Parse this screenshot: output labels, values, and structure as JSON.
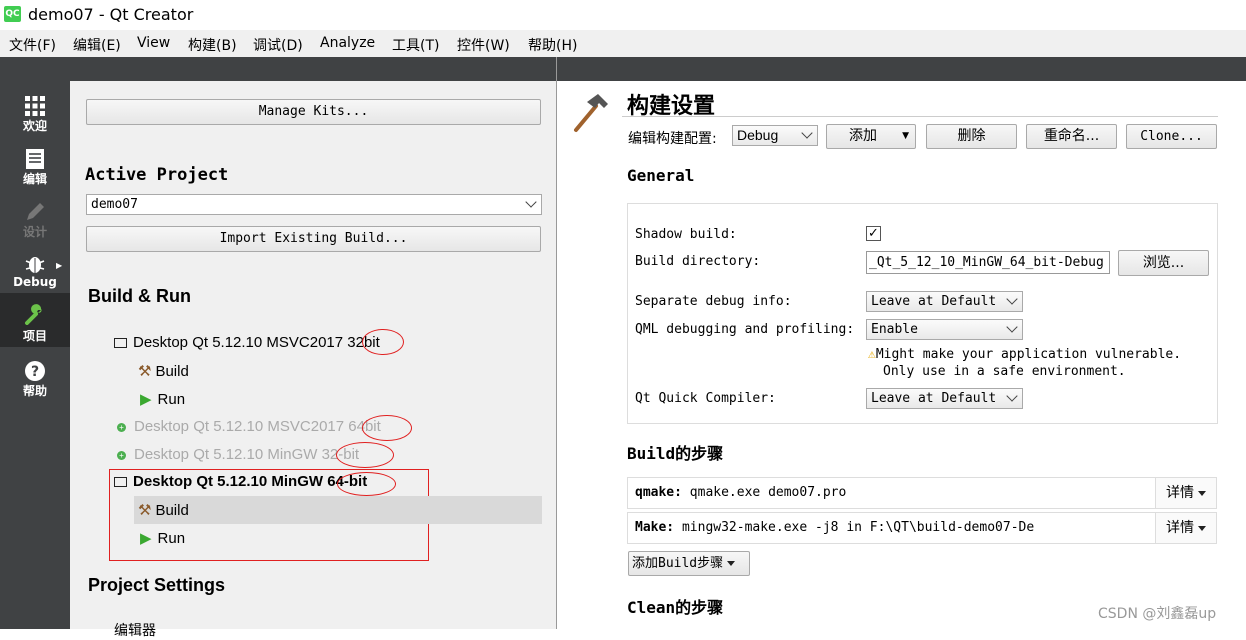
{
  "window": {
    "title": "demo07 - Qt Creator",
    "logo": "QC"
  },
  "menu": [
    "文件(F)",
    "编辑(E)",
    "View",
    "构建(B)",
    "调试(D)",
    "Analyze",
    "工具(T)",
    "控件(W)",
    "帮助(H)"
  ],
  "modes": [
    {
      "label": "欢迎",
      "icon": "welcome-grid-icon"
    },
    {
      "label": "编辑",
      "icon": "edit-document-icon"
    },
    {
      "label": "设计",
      "icon": "design-pen-icon"
    },
    {
      "label": "Debug",
      "icon": "debug-bug-icon"
    },
    {
      "label": "项目",
      "icon": "project-wrench-icon"
    },
    {
      "label": "帮助",
      "icon": "help-question-icon"
    }
  ],
  "left": {
    "manage_kits": "Manage Kits...",
    "active_project_heading": "Active Project",
    "project_select": "demo07",
    "import_build": "Import Existing Build...",
    "build_run_heading": "Build & Run",
    "kits": [
      {
        "name": "Desktop Qt 5.12.10 MSVC2017 32bit",
        "children": [
          "Build",
          "Run"
        ]
      },
      {
        "name": "Desktop Qt 5.12.10 MSVC2017 64bit"
      },
      {
        "name": "Desktop Qt 5.12.10 MinGW 32-bit"
      },
      {
        "name": "Desktop Qt 5.12.10 MinGW 64-bit",
        "children": [
          "Build",
          "Run"
        ]
      }
    ],
    "project_settings_heading": "Project Settings",
    "partial_item": "编辑器"
  },
  "right": {
    "title": "构建设置",
    "edit_config_label": "编辑构建配置:",
    "config_select": "Debug",
    "add_button": "添加",
    "delete_button": "删除",
    "rename_button": "重命名...",
    "clone_button": "Clone...",
    "general_heading": "General",
    "shadow_build_label": "Shadow build:",
    "shadow_build_checked": true,
    "build_dir_label": "Build directory:",
    "build_dir_value": "_Qt_5_12_10_MinGW_64_bit-Debug",
    "browse_button": "浏览...",
    "separate_debug_label": "Separate debug info:",
    "separate_debug_value": "Leave at Default",
    "qml_debug_label": "QML debugging and profiling:",
    "qml_debug_value": "Enable",
    "warning_line1": "Might make your application vulnerable.",
    "warning_line2": "Only use in a safe environment.",
    "qt_quick_label": "Qt Quick Compiler:",
    "qt_quick_value": "Leave at Default",
    "build_steps_heading": "Build的步骤",
    "steps": [
      {
        "name": "qmake:",
        "cmd": "qmake.exe demo07.pro",
        "detail": "详情"
      },
      {
        "name": "Make:",
        "cmd": "mingw32-make.exe -j8 in F:\\QT\\build-demo07-De",
        "detail": "详情"
      }
    ],
    "add_build_step": "添加Build步骤",
    "clean_steps_heading": "Clean的步骤"
  },
  "watermark": "CSDN @刘鑫磊up",
  "colors": {
    "sidebar": "#404244",
    "annotation_red": "#e02020",
    "run_green": "#3aa830"
  }
}
